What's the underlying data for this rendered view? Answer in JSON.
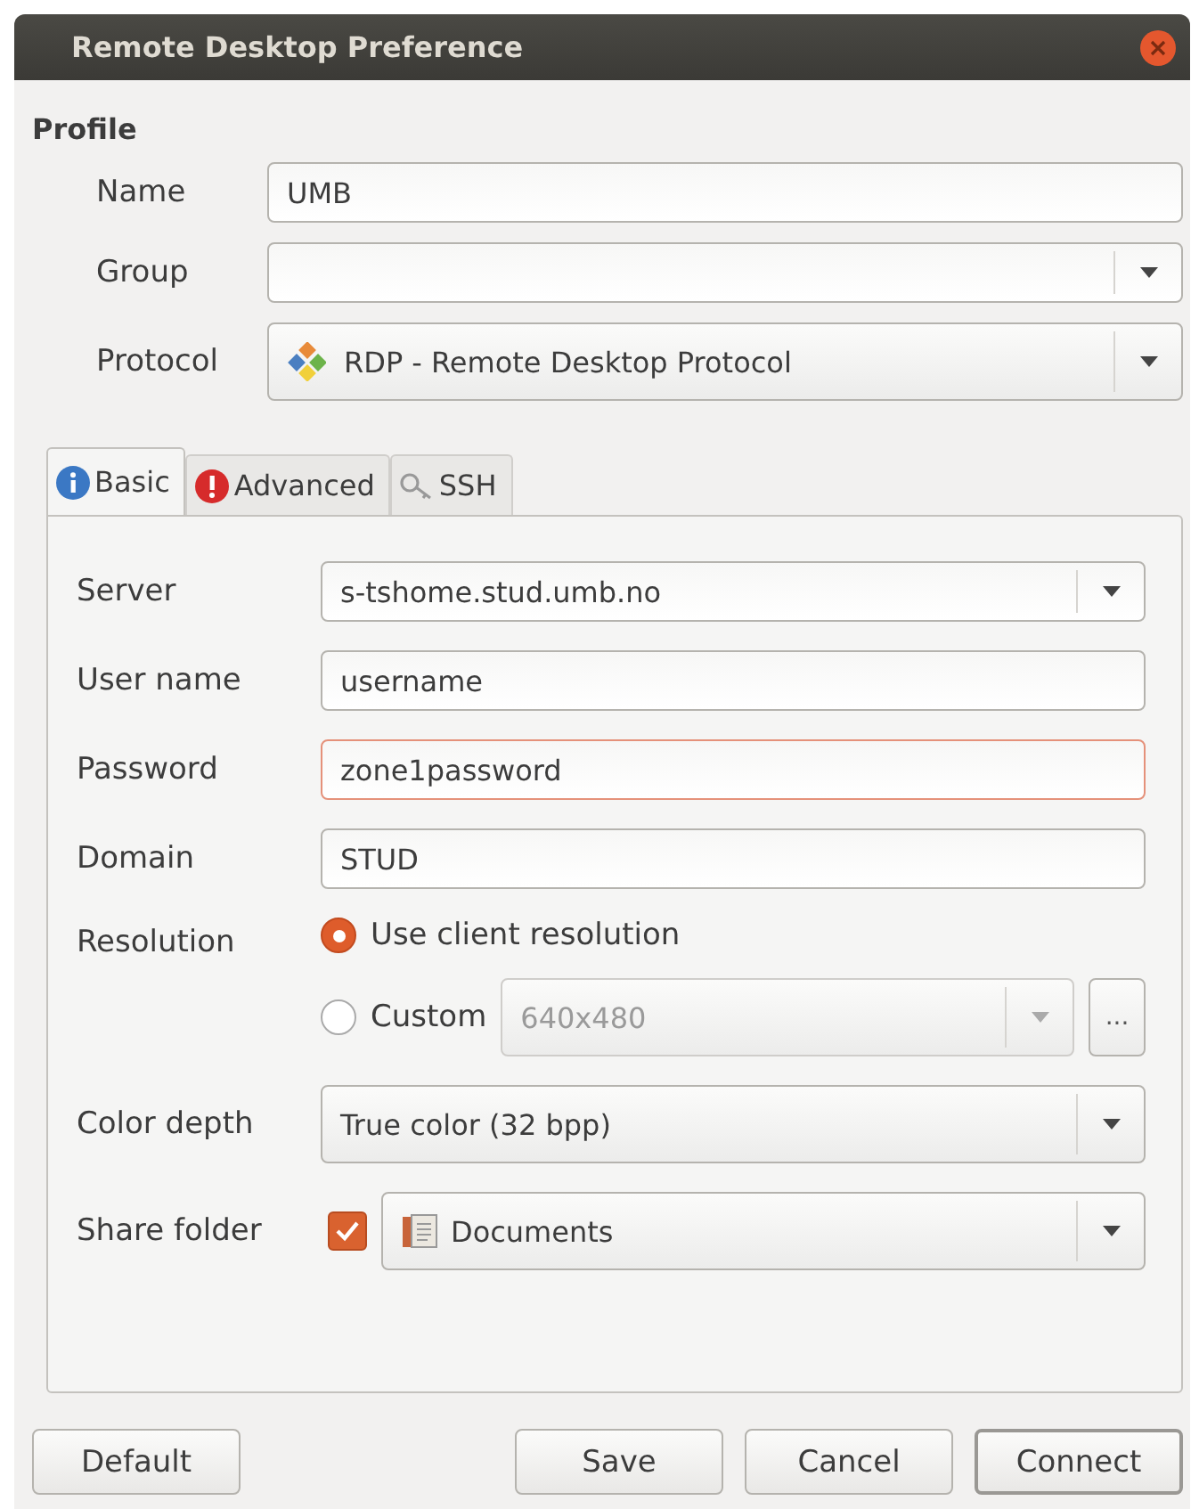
{
  "window": {
    "title": "Remote Desktop Preference"
  },
  "profile": {
    "heading": "Profile",
    "fields": [
      {
        "label": "Name",
        "kind": "entry",
        "value": "UMB"
      },
      {
        "label": "Group",
        "kind": "combo"
      },
      {
        "label": "Protocol",
        "kind": "combo-icon",
        "value": "RDP - Remote Desktop Protocol"
      }
    ]
  },
  "tabs": [
    {
      "label": "Basic",
      "kind": "info",
      "selected": true
    },
    {
      "label": "Advanced",
      "kind": "warning",
      "selected": false
    },
    {
      "label": "SSH",
      "kind": "key",
      "selected": false
    }
  ],
  "basic": [
    {
      "label": "Server",
      "kind": "combo-entry",
      "value": "s-tshome.stud.umb.no"
    },
    {
      "label": "User name",
      "kind": "entry",
      "value": "username",
      "focused": false
    },
    {
      "label": "Password",
      "kind": "entry",
      "value": "zone1password",
      "focused": true
    },
    {
      "label": "Domain",
      "kind": "entry",
      "value": "STUD",
      "focused": false
    },
    {
      "label": "Resolution",
      "kind": "radios",
      "options": [
        {
          "label": "Use client resolution",
          "selected": true
        },
        {
          "label": "Custom",
          "selected": false,
          "value": "640x480",
          "more": "..."
        }
      ]
    },
    {
      "label": "Color depth",
      "kind": "combo",
      "value": "True color (32 bpp)"
    },
    {
      "label": "Share folder",
      "kind": "check-combo",
      "checked": true,
      "value": "Documents"
    }
  ],
  "buttons": [
    {
      "label": "Default",
      "default": false
    },
    {
      "label": "Save",
      "default": false
    },
    {
      "label": "Cancel",
      "default": false
    },
    {
      "label": "Connect",
      "default": true
    }
  ]
}
